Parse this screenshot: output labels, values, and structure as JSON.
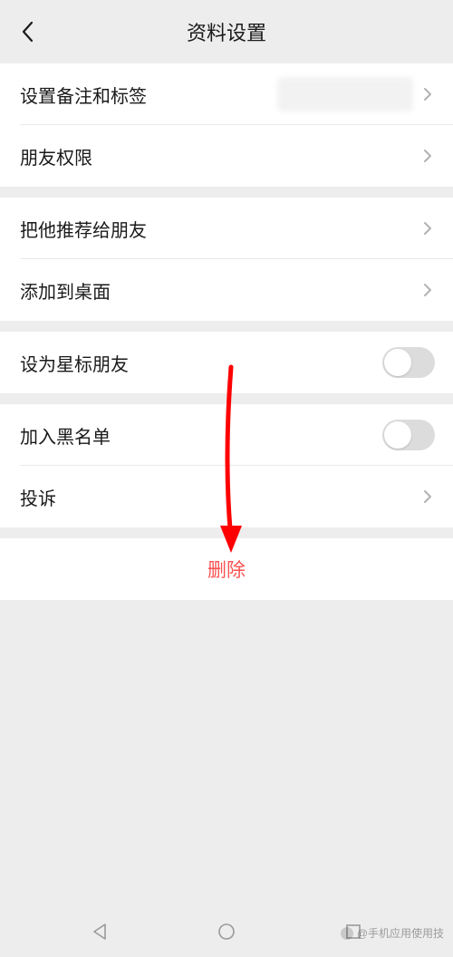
{
  "header": {
    "title": "资料设置"
  },
  "groups": [
    {
      "rows": [
        {
          "label": "设置备注和标签",
          "has_blurred_value": true,
          "has_chevron": true
        },
        {
          "label": "朋友权限",
          "has_chevron": true
        }
      ]
    },
    {
      "rows": [
        {
          "label": "把他推荐给朋友",
          "has_chevron": true
        },
        {
          "label": "添加到桌面",
          "has_chevron": true
        }
      ]
    },
    {
      "rows": [
        {
          "label": "设为星标朋友",
          "has_toggle": true,
          "toggle_on": false
        }
      ]
    },
    {
      "rows": [
        {
          "label": "加入黑名单",
          "has_toggle": true,
          "toggle_on": false
        },
        {
          "label": "投诉",
          "has_chevron": true
        }
      ]
    }
  ],
  "delete": {
    "label": "删除"
  },
  "watermark": {
    "text": "@手机应用使用技"
  }
}
